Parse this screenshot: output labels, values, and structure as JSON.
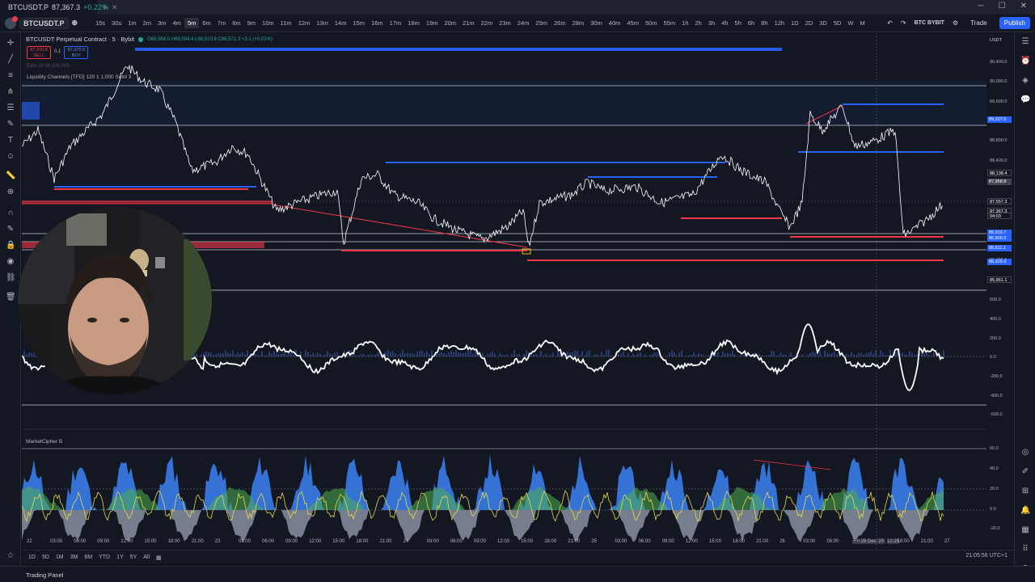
{
  "browser": {
    "tab_symbol": "BTCUSDT.P",
    "tab_price": "87,367.3",
    "tab_change": "+0.22%",
    "new_tab_icon": "plus-icon"
  },
  "toolbar": {
    "symbol": "BTCUSDT.P",
    "intervals": [
      "15s",
      "30s",
      "1m",
      "2m",
      "3m",
      "4m",
      "5m",
      "6m",
      "7m",
      "8m",
      "9m",
      "10m",
      "11m",
      "12m",
      "13m",
      "14m",
      "15m",
      "16m",
      "17m",
      "18m",
      "19m",
      "20m",
      "21m",
      "22m",
      "23m",
      "24m",
      "25m",
      "26m",
      "28m",
      "30m",
      "40m",
      "45m",
      "50m",
      "55m",
      "1h",
      "2h",
      "3h",
      "4h",
      "5h",
      "6h",
      "8h",
      "12h",
      "1D",
      "2D",
      "3D",
      "5D",
      "W",
      "M"
    ],
    "active_interval": "5m",
    "layout_name": "BTC BYBIT",
    "layout_sub": "Save",
    "trade_label": "Trade",
    "publish_label": "Publish"
  },
  "legend": {
    "title": "BTCUSDT Perpetual Contract · 5 · Bybit",
    "ohlc": "O88,568.0  H88,594.4  L88,510.9  C88,571.3  +3.1 (+0.01%)",
    "sell_price": "87,370.8",
    "sell_label": "SELL",
    "spread": "0.1",
    "buy_price": "87,370.9",
    "buy_label": "BUY",
    "ema_label": "EMA 20 50 100 200",
    "indicator1": "Liquidity Channels [TFO] 120 1 1,000 Solid 3",
    "indicator2": "MarketCipher B"
  },
  "price_scale": {
    "unit": "USDT",
    "labels": [
      "90,400.0",
      "90,000.0",
      "89,600.0",
      "88,800.0",
      "88,400.0",
      "88,000.0",
      "87,600.0",
      "86,400.0",
      "85,600.0"
    ],
    "osc_labels": [
      "600.0",
      "400.0",
      "200.0",
      "0.0",
      "-200.0",
      "-400.0",
      "-600.0"
    ],
    "mc_labels": [
      "60.0",
      "40.0",
      "20.0",
      "0.0",
      "-20.0"
    ],
    "tags": [
      {
        "text": "89,227.5",
        "color": "#2962ff"
      },
      {
        "text": "88,138.4",
        "color": "#131722"
      },
      {
        "text": "87,958.8",
        "color": "#434651"
      },
      {
        "text": "87,557.3",
        "color": "#131722"
      },
      {
        "text": "87,367.3",
        "color": "#131722"
      },
      {
        "text": "04:03",
        "color": "#131722"
      },
      {
        "text": "86,919.7",
        "color": "#2962ff"
      },
      {
        "text": "86,800.0",
        "color": "#2962ff"
      },
      {
        "text": "86,611.1",
        "color": "#2962ff"
      },
      {
        "text": "86,329.3",
        "color": "#2962ff"
      },
      {
        "text": "85,961.1",
        "color": "#131722"
      }
    ]
  },
  "time_axis": {
    "labels": [
      "22",
      "03:00",
      "06:00",
      "09:00",
      "12:00",
      "15:00",
      "18:00",
      "21:00",
      "23",
      "03:00",
      "06:00",
      "09:00",
      "12:00",
      "15:00",
      "18:00",
      "21:00",
      "24",
      "03:00",
      "06:00",
      "09:00",
      "12:00",
      "15:00",
      "18:00",
      "21:00",
      "25",
      "03:00",
      "06:00",
      "09:00",
      "12:00",
      "15:00",
      "18:00",
      "21:00",
      "26",
      "03:00",
      "06:00",
      "Fri 26 Dec '25",
      "12:25",
      "18:00",
      "21:00",
      "27"
    ]
  },
  "range_bar": {
    "ranges": [
      "1D",
      "5D",
      "1M",
      "3M",
      "6M",
      "YTD",
      "1Y",
      "5Y",
      "All"
    ],
    "clock": "21:05:56 UTC+1"
  },
  "bottom": {
    "trading_panel": "Trading Panel"
  },
  "colors": {
    "bg": "#131722",
    "blue_line": "#2962ff",
    "red_line": "#f23645",
    "price_line": "#ffffff",
    "mc_blue": "#3b82f6",
    "mc_green": "#4caf50",
    "mc_yellow": "#e6d84a"
  }
}
